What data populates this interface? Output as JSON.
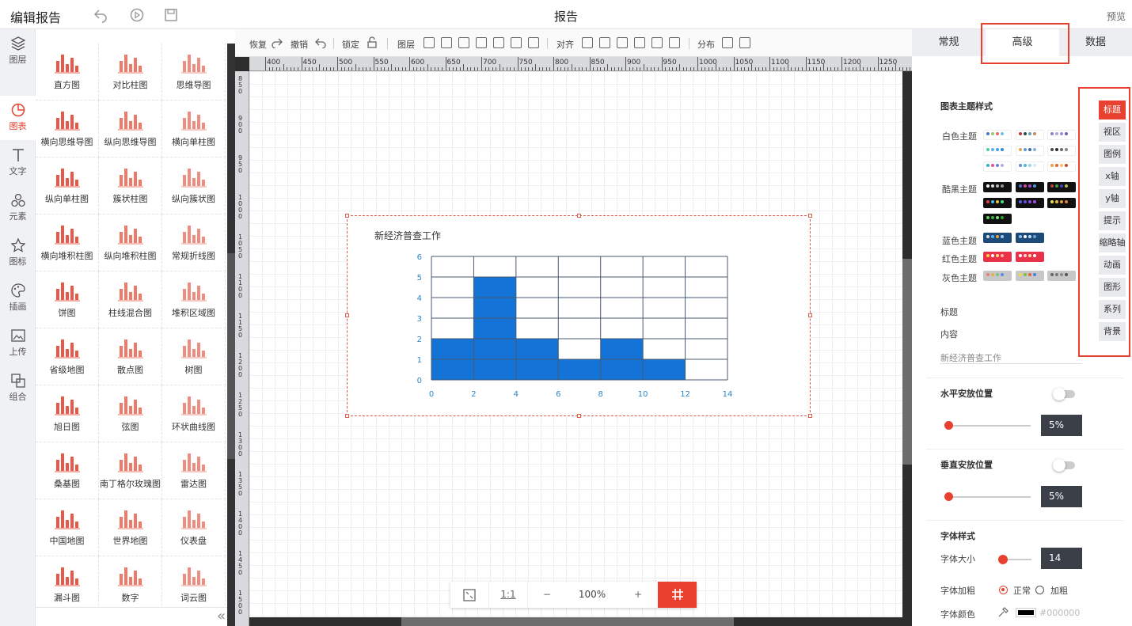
{
  "app": {
    "title": "编辑报告",
    "page_title": "报告",
    "preview": "预览"
  },
  "left_nav": [
    {
      "label": "图层",
      "icon": "layers-icon"
    },
    {
      "label": "图表",
      "icon": "chart-icon"
    },
    {
      "label": "文字",
      "icon": "text-icon"
    },
    {
      "label": "元素",
      "icon": "elements-icon"
    },
    {
      "label": "图标",
      "icon": "star-icon"
    },
    {
      "label": "插画",
      "icon": "palette-icon"
    },
    {
      "label": "上传",
      "icon": "upload-image-icon"
    },
    {
      "label": "组合",
      "icon": "group-icon"
    }
  ],
  "palette": [
    "直方图",
    "对比柱图",
    "思维导图",
    "横向思维导图",
    "纵向思维导图",
    "横向单柱图",
    "纵向单柱图",
    "簇状柱图",
    "纵向簇状图",
    "横向堆积柱图",
    "纵向堆积柱图",
    "常规折线图",
    "饼图",
    "柱线混合图",
    "堆积区域图",
    "省级地图",
    "散点图",
    "树图",
    "旭日图",
    "弦图",
    "环状曲线图",
    "桑基图",
    "南丁格尔玫瑰图",
    "雷达图",
    "中国地图",
    "世界地图",
    "仪表盘",
    "漏斗图",
    "数字",
    "词云图"
  ],
  "toolbar": {
    "redo": "恢复",
    "undo": "撤销",
    "lock": "锁定",
    "layer": "图层",
    "align": "对齐",
    "distribute": "分布"
  },
  "ruler": {
    "h": [
      "400",
      "450",
      "500",
      "550",
      "600",
      "650",
      "700",
      "750",
      "800",
      "850",
      "900",
      "950",
      "1000",
      "1050",
      "1100",
      "1150",
      "1200",
      "1250"
    ],
    "v": [
      "850",
      "900",
      "950",
      "1000",
      "1050",
      "1100",
      "1150",
      "1200",
      "1250",
      "1300",
      "1350",
      "1400",
      "1450",
      "1500"
    ]
  },
  "chart_data": {
    "type": "bar",
    "title": "新经济普查工作",
    "x": [
      0,
      2,
      4,
      6,
      8,
      10,
      12,
      14
    ],
    "bins": [
      [
        0,
        2,
        2
      ],
      [
        2,
        4,
        5
      ],
      [
        4,
        6,
        2
      ],
      [
        6,
        8,
        1
      ],
      [
        8,
        10,
        2
      ],
      [
        10,
        12,
        1
      ]
    ],
    "xlim": [
      0,
      14
    ],
    "ylim": [
      0,
      6
    ],
    "yticks": [
      0,
      1,
      2,
      3,
      4,
      5,
      6
    ],
    "grid": true,
    "bar_color": "#1373d6"
  },
  "zoom": {
    "fit": "",
    "one_to_one": "1:1",
    "minus": "−",
    "level": "100%",
    "plus": "+"
  },
  "right_panel": {
    "tabs": [
      "常规",
      "高级",
      "数据"
    ],
    "sub_tabs": [
      "标题",
      "视区",
      "图例",
      "x轴",
      "y轴",
      "提示",
      "缩略轴",
      "动画",
      "图形",
      "系列",
      "背景"
    ],
    "theme_section": "图表主题样式",
    "themes": {
      "white": "白色主题",
      "dark": "酷黑主题",
      "blue": "蓝色主题",
      "red": "红色主题",
      "gray": "灰色主题"
    },
    "title_label": "标题",
    "content_label": "内容",
    "content_value": "新经济普查工作",
    "h_pos_label": "水平安放位置",
    "h_pos_value": "5%",
    "v_pos_label": "垂直安放位置",
    "v_pos_value": "5%",
    "font_style_label": "字体样式",
    "font_size_label": "字体大小",
    "font_size_value": "14",
    "font_weight_label": "字体加粗",
    "weight_normal": "正常",
    "weight_bold": "加粗",
    "font_color_label": "字体颜色",
    "font_color_value": "#000000"
  },
  "colors": {
    "accent": "#e8412f",
    "bar": "#1373d6",
    "dark_box": "#3a3f48"
  }
}
